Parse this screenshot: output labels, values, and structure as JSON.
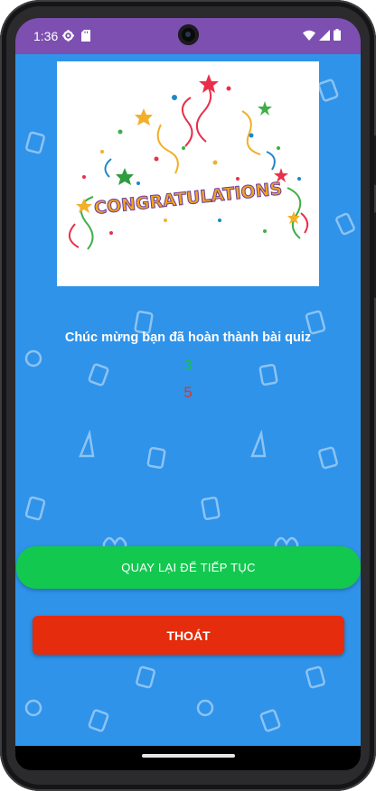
{
  "status_bar": {
    "time": "1:36",
    "icons": [
      "gear-icon",
      "sd-card-icon",
      "wifi-icon",
      "cell-signal-icon",
      "battery-icon"
    ],
    "color": "#7d4fb0"
  },
  "result": {
    "image_text": "CONGRATULATIONS",
    "message": "Chúc mừng bạn đã hoàn thành bài quiz",
    "correct": "3",
    "total": "5"
  },
  "actions": {
    "continue_label": "QUAY LẠI ĐỂ TIẾP TỤC",
    "exit_label": "THOÁT"
  },
  "colors": {
    "background": "#2f93ea",
    "continue_button": "#13c84f",
    "exit_button": "#e52c0c",
    "correct_text": "#16c24a",
    "total_text": "#e0342b"
  }
}
